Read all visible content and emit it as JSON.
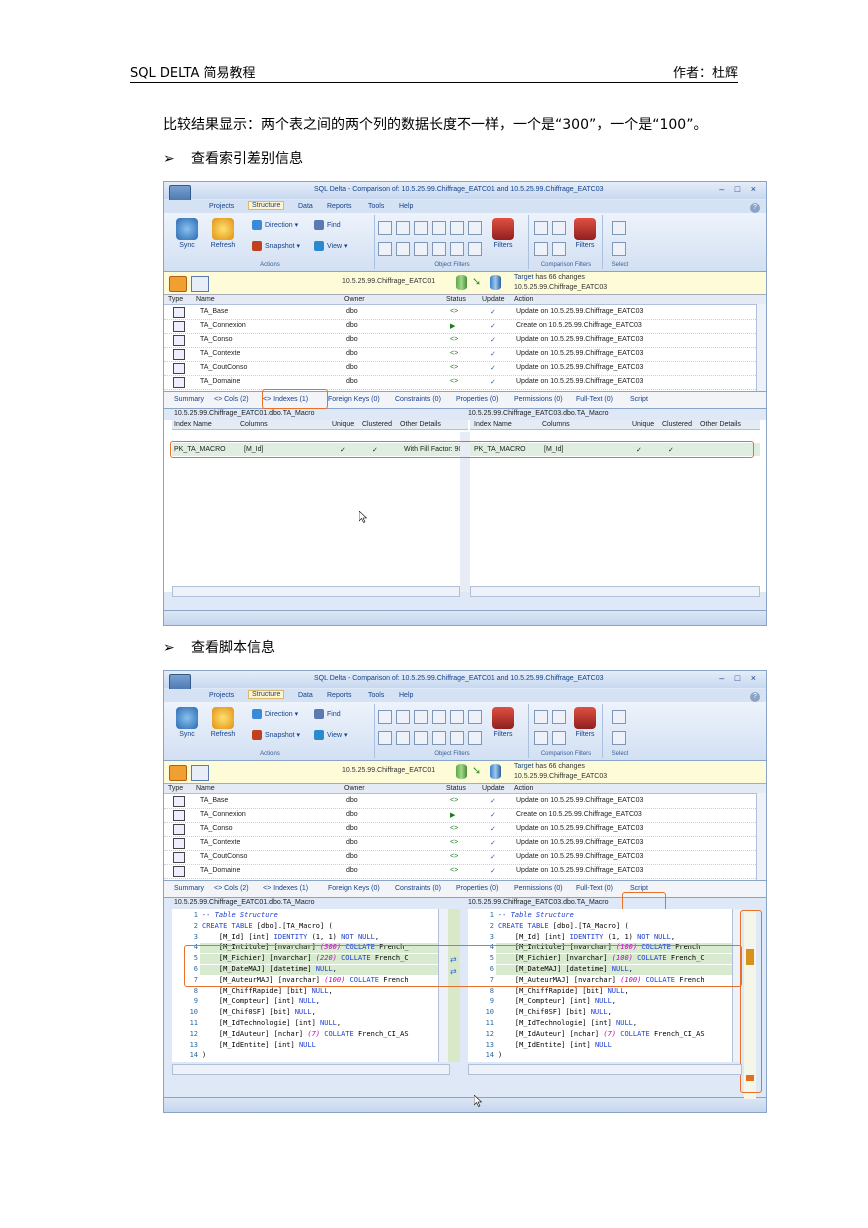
{
  "header": {
    "left": "SQL DELTA 简易教程",
    "right": "作者：杜辉"
  },
  "intro": "比较结果显示：两个表之间的两个列的数据长度不一样，一个是“300”，一个是“100”。",
  "bullet_marker": "➢",
  "section1_title": "查看索引差别信息",
  "section2_title": "查看脚本信息",
  "app": {
    "title": "SQL Delta - Comparison of: 10.5.25.99.Chiffrage_EATC01 and 10.5.25.99.Chiffrage_EATC03",
    "window_controls": "– □ ×",
    "help": "?",
    "menu": [
      "Projects",
      "Structure",
      "Data",
      "Reports",
      "Tools",
      "Help"
    ],
    "ribbon": {
      "sync": "Sync",
      "refresh": "Refresh",
      "direction": "Direction",
      "snapshot": "Snapshot",
      "find": "Find",
      "view": "View",
      "filters": "Filters",
      "filters2": "Filters",
      "groups": [
        "Actions",
        "Object Filters",
        "Comparison Filters",
        "Select"
      ]
    },
    "connection": {
      "source": "10.5.25.99.Chiffrage_EATC01",
      "target_prefix": "Target",
      "target_changes": " has 66 changes",
      "target": "10.5.25.99.Chiffrage_EATC03"
    },
    "grid": {
      "headers": [
        "Type",
        "Name",
        "Owner",
        "Status",
        "Update",
        "Action"
      ],
      "rows": [
        {
          "name": "TA_Base",
          "owner": "dbo",
          "status": "<>",
          "update": "✓",
          "action": "Update on 10.5.25.99.Chiffrage_EATC03"
        },
        {
          "name": "TA_Connexion",
          "owner": "dbo",
          "status": "▶",
          "update": "✓",
          "action": "Create on 10.5.25.99.Chiffrage_EATC03"
        },
        {
          "name": "TA_Conso",
          "owner": "dbo",
          "status": "<>",
          "update": "✓",
          "action": "Update on 10.5.25.99.Chiffrage_EATC03"
        },
        {
          "name": "TA_Contexte",
          "owner": "dbo",
          "status": "<>",
          "update": "✓",
          "action": "Update on 10.5.25.99.Chiffrage_EATC03"
        },
        {
          "name": "TA_CoutConso",
          "owner": "dbo",
          "status": "<>",
          "update": "✓",
          "action": "Update on 10.5.25.99.Chiffrage_EATC03"
        },
        {
          "name": "TA_Domaine",
          "owner": "dbo",
          "status": "<>",
          "update": "✓",
          "action": "Update on 10.5.25.99.Chiffrage_EATC03"
        }
      ]
    },
    "tabs": [
      "Summary",
      "<> Cols (2)",
      "<> Indexes (1)",
      "Foreign Keys (0)",
      "Constraints (0)",
      "Properties (0)",
      "Permissions (0)",
      "Full-Text (0)",
      "Script"
    ],
    "left_table": "10.5.25.99.Chiffrage_EATC01.dbo.TA_Macro",
    "right_table": "10.5.25.99.Chiffrage_EATC03.dbo.TA_Macro",
    "index_headers": [
      "Index Name",
      "Columns",
      "Unique",
      "Clustered",
      "Other Details"
    ],
    "index_left": {
      "name": "PK_TA_MACRO",
      "columns": "[M_Id]",
      "unique": "✓",
      "clustered": "✓",
      "other": "With Fill Factor: 90"
    },
    "index_right": {
      "name": "PK_TA_MACRO",
      "columns": "[M_Id]",
      "unique": "✓",
      "clustered": "✓"
    },
    "script_left": [
      {
        "n": "1",
        "t": "-- Table Structure"
      },
      {
        "n": "2",
        "t": "CREATE TABLE [dbo].[TA_Macro] ("
      },
      {
        "n": "3",
        "t": "    [M_Id] [int] IDENTITY (1, 1) NOT NULL,"
      },
      {
        "n": "4",
        "t": "    [M_Intitule] [nvarchar] (300) COLLATE French_"
      },
      {
        "n": "5",
        "t": "    [M_Fichier] [nvarchar] (220) COLLATE French_C"
      },
      {
        "n": "6",
        "t": "    [M_DateMAJ] [datetime] NULL,"
      },
      {
        "n": "7",
        "t": "    [M_AuteurMAJ] [nvarchar] (100) COLLATE French"
      },
      {
        "n": "8",
        "t": "    [M_ChiffRapide] [bit] NULL,"
      },
      {
        "n": "9",
        "t": "    [M_Compteur] [int] NULL,"
      },
      {
        "n": "10",
        "t": "    [M_Chif0SF] [bit] NULL,"
      },
      {
        "n": "11",
        "t": "    [M_IdTechnologie] [int] NULL,"
      },
      {
        "n": "12",
        "t": "    [M_IdAuteur] [nchar] (7) COLLATE French_CI_AS"
      },
      {
        "n": "13",
        "t": "    [M_IdEntite] [int] NULL"
      },
      {
        "n": "14",
        "t": ")"
      }
    ],
    "script_right": [
      {
        "n": "1",
        "t": "-- Table Structure"
      },
      {
        "n": "2",
        "t": "CREATE TABLE [dbo].[TA_Macro] ("
      },
      {
        "n": "3",
        "t": "    [M_Id] [int] IDENTITY (1, 1) NOT NULL,"
      },
      {
        "n": "4",
        "t": "    [M_Intitule] [nvarchar] (100) COLLATE French"
      },
      {
        "n": "5",
        "t": "    [M_Fichier] [nvarchar] (100) COLLATE French_C"
      },
      {
        "n": "6",
        "t": "    [M_DateMAJ] [datetime] NULL,"
      },
      {
        "n": "7",
        "t": "    [M_AuteurMAJ] [nvarchar] (100) COLLATE French"
      },
      {
        "n": "8",
        "t": "    [M_ChiffRapide] [bit] NULL,"
      },
      {
        "n": "9",
        "t": "    [M_Compteur] [int] NULL,"
      },
      {
        "n": "10",
        "t": "    [M_Chif0SF] [bit] NULL,"
      },
      {
        "n": "11",
        "t": "    [M_IdTechnologie] [int] NULL,"
      },
      {
        "n": "12",
        "t": "    [M_IdAuteur] [nchar] (7) COLLATE French_CI_AS"
      },
      {
        "n": "13",
        "t": "    [M_IdEntite] [int] NULL"
      },
      {
        "n": "14",
        "t": ")"
      }
    ]
  }
}
